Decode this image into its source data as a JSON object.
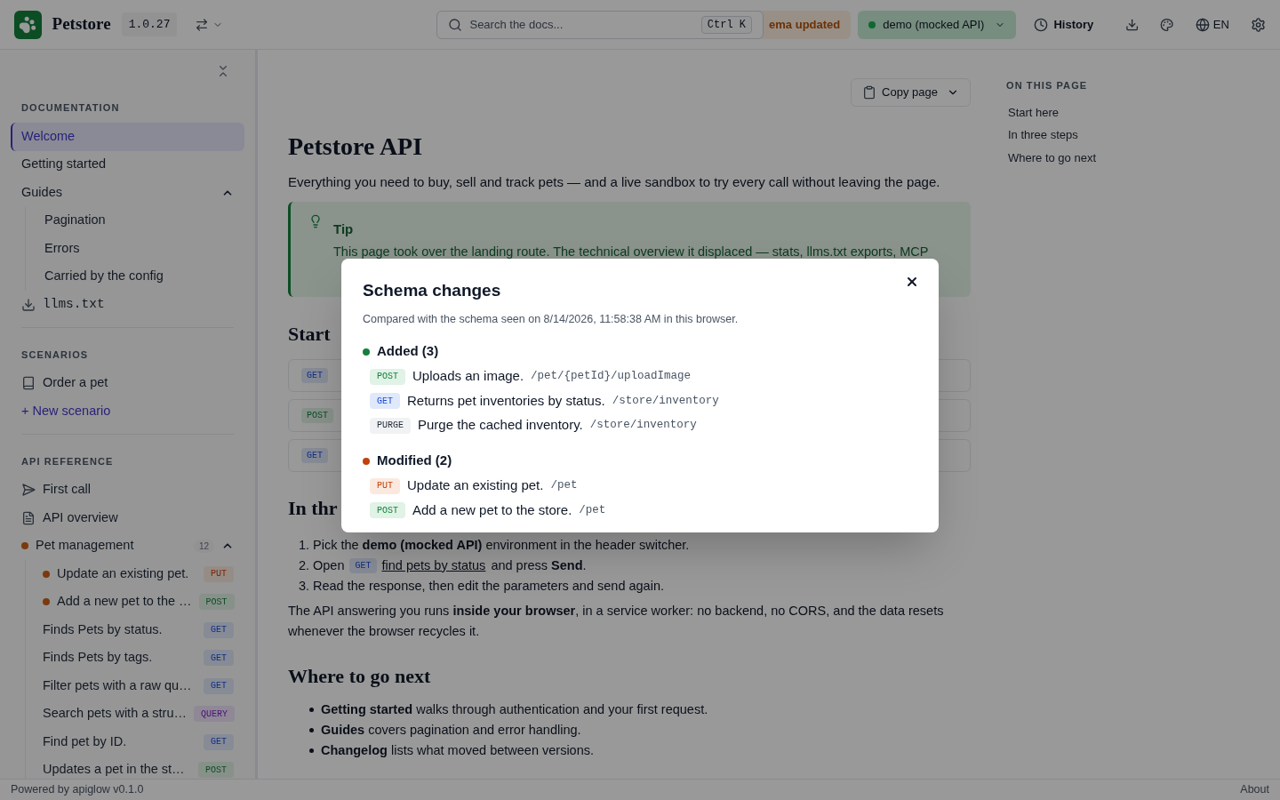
{
  "header": {
    "brand": "Petstore",
    "version": "1.0.27",
    "search": {
      "placeholder": "Search the docs...",
      "shortcut": "Ctrl K"
    },
    "schema_badge": "ema updated",
    "environment": {
      "label": "demo (mocked API)",
      "color": "#0e6a30"
    },
    "history": "History",
    "language": "EN"
  },
  "sidebar": {
    "sections": [
      {
        "title": "DOCUMENTATION",
        "items": [
          {
            "kind": "page",
            "label": "Welcome",
            "selected": true
          },
          {
            "kind": "page",
            "label": "Getting started",
            "selected": false
          },
          {
            "kind": "group",
            "label": "Guides",
            "selected": false,
            "expanded": true,
            "children": [
              {
                "kind": "page",
                "label": "Pagination",
                "selected": false
              },
              {
                "kind": "page",
                "label": "Errors",
                "selected": false
              },
              {
                "kind": "page",
                "label": "Carried by the config",
                "selected": false
              }
            ]
          },
          {
            "kind": "download",
            "label": "llms.txt",
            "selected": false
          }
        ]
      },
      {
        "title": "SCENARIOS",
        "items": [
          {
            "kind": "scenario",
            "label": "Order a pet",
            "selected": false
          },
          {
            "kind": "action",
            "label": "+ New scenario",
            "selected": false
          }
        ]
      },
      {
        "title": "API REFERENCE",
        "items": [
          {
            "kind": "request",
            "label": "First call",
            "selected": false
          },
          {
            "kind": "overview",
            "label": "API overview",
            "selected": false
          },
          {
            "kind": "group",
            "label": "Pet management",
            "selected": false,
            "expanded": true,
            "count": "12",
            "color": "#7a3a0c",
            "children": [
              {
                "kind": "endpoint",
                "label": "Update an existing pet.",
                "method": {
                  "label": "PUT",
                  "kind": "put"
                },
                "color": "#7a3a0c",
                "selected": false
              },
              {
                "kind": "endpoint",
                "label": "Add a new pet to the …",
                "method": {
                  "label": "POST",
                  "kind": "post"
                },
                "color": "#7a3a0c",
                "selected": false
              },
              {
                "kind": "endpoint",
                "label": "Finds Pets by status.",
                "method": {
                  "label": "GET",
                  "kind": "get"
                },
                "selected": false
              },
              {
                "kind": "endpoint",
                "label": "Finds Pets by tags.",
                "method": {
                  "label": "GET",
                  "kind": "get"
                },
                "selected": false
              },
              {
                "kind": "endpoint",
                "label": "Filter pets with a raw qu…",
                "method": {
                  "label": "GET",
                  "kind": "get"
                },
                "selected": false
              },
              {
                "kind": "endpoint",
                "label": "Search pets with a stru…",
                "method": {
                  "label": "QUERY",
                  "kind": "query"
                },
                "selected": false
              },
              {
                "kind": "endpoint",
                "label": "Find pet by ID.",
                "method": {
                  "label": "GET",
                  "kind": "get"
                },
                "selected": false
              },
              {
                "kind": "endpoint",
                "label": "Updates a pet in the st…",
                "method": {
                  "label": "POST",
                  "kind": "post"
                },
                "selected": false
              }
            ]
          }
        ]
      }
    ]
  },
  "main": {
    "copy_button": "Copy page",
    "title": "Petstore API",
    "intro": "Everything you need to buy, sell and track pets — and a live sandbox to try every call without leaving the page.",
    "tip": {
      "title": "Tip",
      "text": "This page took over the landing route. The technical overview it displaced — stats, llms.txt exports, MCP"
    },
    "start": {
      "heading": "Start",
      "cards": [
        {
          "method": {
            "label": "GET",
            "kind": "get"
          }
        },
        {
          "method": {
            "label": "POST",
            "kind": "post"
          }
        },
        {
          "method": {
            "label": "GET",
            "kind": "get"
          }
        }
      ]
    },
    "steps": {
      "heading": "In thr",
      "items": [
        {
          "kind": "text",
          "number": "1.",
          "text": "Pick the **demo (mocked API)** environment in the header switcher."
        },
        {
          "kind": "link",
          "number": "2.",
          "before": "Open",
          "method": {
            "label": "GET",
            "kind": "get"
          },
          "link": "find pets by status",
          "after": "and press **Send**."
        },
        {
          "kind": "text",
          "number": "3.",
          "text": "Read the response, then edit the parameters and send again."
        }
      ]
    },
    "paragraph": "The API answering you runs **inside your browser**, in a service worker: no backend, no CORS, and the data resets whenever the browser recycles it.",
    "next": {
      "heading": "Where to go next",
      "items": [
        "**Getting started** walks through authentication and your first request.",
        "**Guides** covers pagination and error handling.",
        "**Changelog** lists what moved between versions."
      ]
    }
  },
  "toc": {
    "title": "ON THIS PAGE",
    "items": [
      "Start here",
      "In three steps",
      "Where to go next"
    ]
  },
  "footer": {
    "left": "Powered by apiglow v0.1.0",
    "right": "About"
  },
  "modal": {
    "title": "Schema changes",
    "subtitle": "Compared with the schema seen on 8/14/2026, 11:58:38 AM in this browser.",
    "groups": [
      {
        "title": "Added (3)",
        "color": "#15803d",
        "items": [
          {
            "method": {
              "label": "POST",
              "kind": "post"
            },
            "summary": "Uploads an image.",
            "path": "/pet/{petId}/uploadImage"
          },
          {
            "method": {
              "label": "GET",
              "kind": "get"
            },
            "summary": "Returns pet inventories by status.",
            "path": "/store/inventory"
          },
          {
            "method": {
              "label": "PURGE",
              "kind": "purge"
            },
            "summary": "Purge the cached inventory.",
            "path": "/store/inventory"
          }
        ]
      },
      {
        "title": "Modified (2)",
        "color": "#c2410c",
        "items": [
          {
            "method": {
              "label": "PUT",
              "kind": "put"
            },
            "summary": "Update an existing pet.",
            "path": "/pet"
          },
          {
            "method": {
              "label": "POST",
              "kind": "post"
            },
            "summary": "Add a new pet to the store.",
            "path": "/pet"
          }
        ]
      }
    ]
  }
}
